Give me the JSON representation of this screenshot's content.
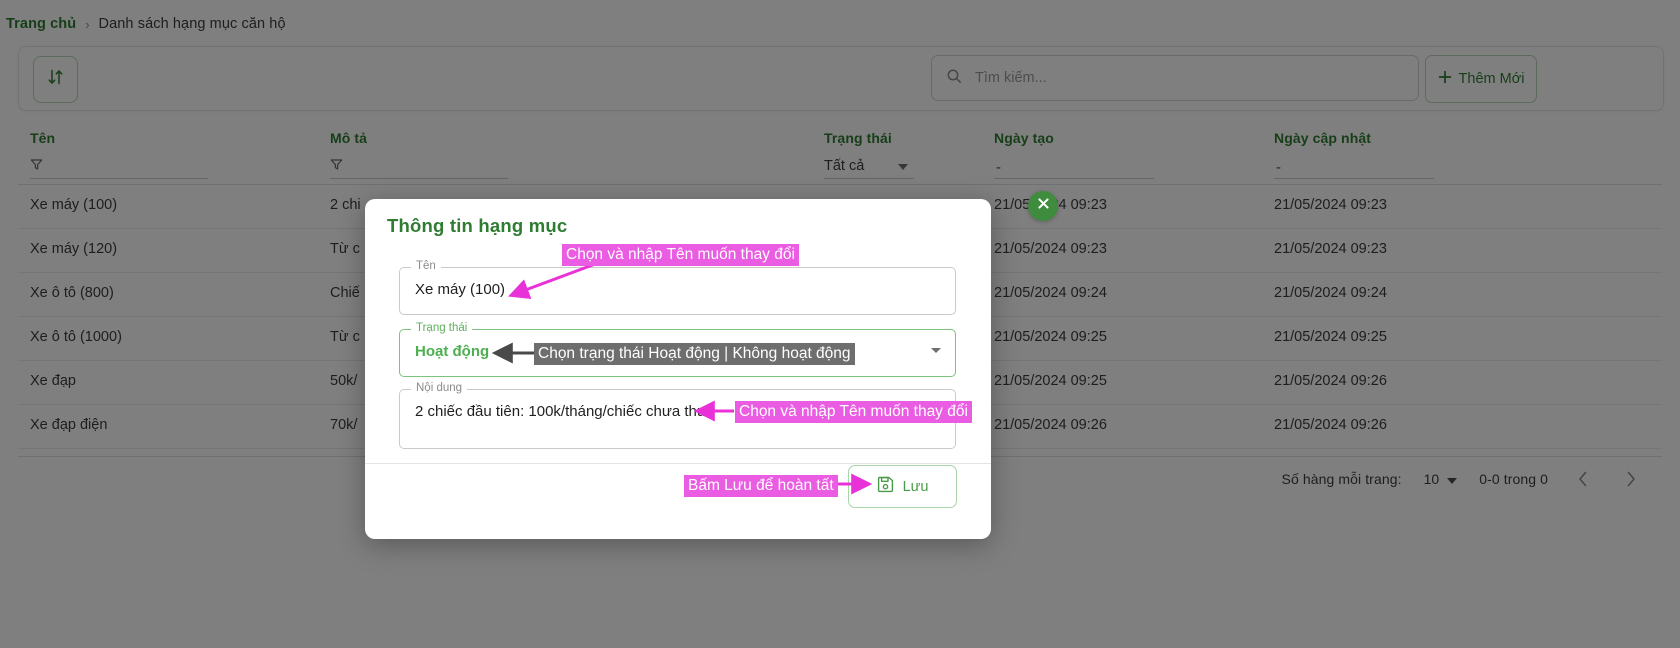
{
  "breadcrumb": {
    "home": "Trang chủ",
    "separator": "›",
    "current": "Danh sách hạng mục căn hộ"
  },
  "toolbar": {
    "sort_icon": "sort-arrows-icon",
    "search_placeholder": "Tìm kiếm...",
    "search_value": "",
    "add_label": "Thêm Mới",
    "add_icon": "plus-icon"
  },
  "table": {
    "columns": [
      {
        "key": "name",
        "label": "Tên",
        "filter": "funnel-icon"
      },
      {
        "key": "desc",
        "label": "Mô tả",
        "filter": "funnel-icon"
      },
      {
        "key": "status",
        "label": "Trạng thái",
        "filter_value": "Tất cả"
      },
      {
        "key": "created",
        "label": "Ngày tạo",
        "filter_value": "-"
      },
      {
        "key": "updated",
        "label": "Ngày cập nhật",
        "filter_value": "-"
      }
    ],
    "rows": [
      {
        "name": "Xe máy (100)",
        "desc": "2 chi",
        "created": "21/05/2024 09:23",
        "updated": "21/05/2024 09:23"
      },
      {
        "name": "Xe máy (120)",
        "desc": "Từ c",
        "created": "21/05/2024 09:23",
        "updated": "21/05/2024 09:23"
      },
      {
        "name": "Xe ô tô (800)",
        "desc": "Chiế",
        "created": "21/05/2024 09:24",
        "updated": "21/05/2024 09:24"
      },
      {
        "name": "Xe ô tô (1000)",
        "desc": "Từ c",
        "created": "21/05/2024 09:25",
        "updated": "21/05/2024 09:25"
      },
      {
        "name": "Xe đạp",
        "desc": "50k/",
        "created": "21/05/2024 09:25",
        "updated": "21/05/2024 09:26"
      },
      {
        "name": "Xe đạp điện",
        "desc": "70k/",
        "created": "21/05/2024 09:26",
        "updated": "21/05/2024 09:26"
      }
    ]
  },
  "pagination": {
    "rows_per_page_label": "Số hàng mỗi trang:",
    "rows_per_page_value": "10",
    "range": "0-0 trong 0",
    "prev_icon": "chevron-left-icon",
    "next_icon": "chevron-right-icon"
  },
  "modal": {
    "title": "Thông tin hạng mục",
    "close_icon": "close-icon",
    "fields": {
      "name": {
        "label": "Tên",
        "value": "Xe máy (100)"
      },
      "status": {
        "label": "Trạng thái",
        "value": "Hoạt động",
        "caret": "chevron-down-icon"
      },
      "note": {
        "label": "Nội dung",
        "value": "2 chiếc đầu tiên: 100k/tháng/chiếc chưa thuế"
      }
    },
    "save_label": "Lưu",
    "save_icon": "save-floppy-icon"
  },
  "annotations": [
    {
      "id": "a1",
      "text": "Chọn và nhập Tên muốn thay đổi",
      "style": "magenta"
    },
    {
      "id": "a2",
      "text": "Chọn trạng thái Hoạt động | Không hoạt động",
      "style": "grey"
    },
    {
      "id": "a3",
      "text": "Chọn và nhập Tên muốn thay đổi",
      "style": "magenta"
    },
    {
      "id": "a4",
      "text": "Bấm Lưu để hoàn tất",
      "style": "magenta"
    }
  ],
  "colors": {
    "brand_green": "#2e7d32",
    "accent_green": "#4caf50",
    "annotation_magenta": "#ea5ce2",
    "annotation_grey": "#6e6e6e"
  }
}
